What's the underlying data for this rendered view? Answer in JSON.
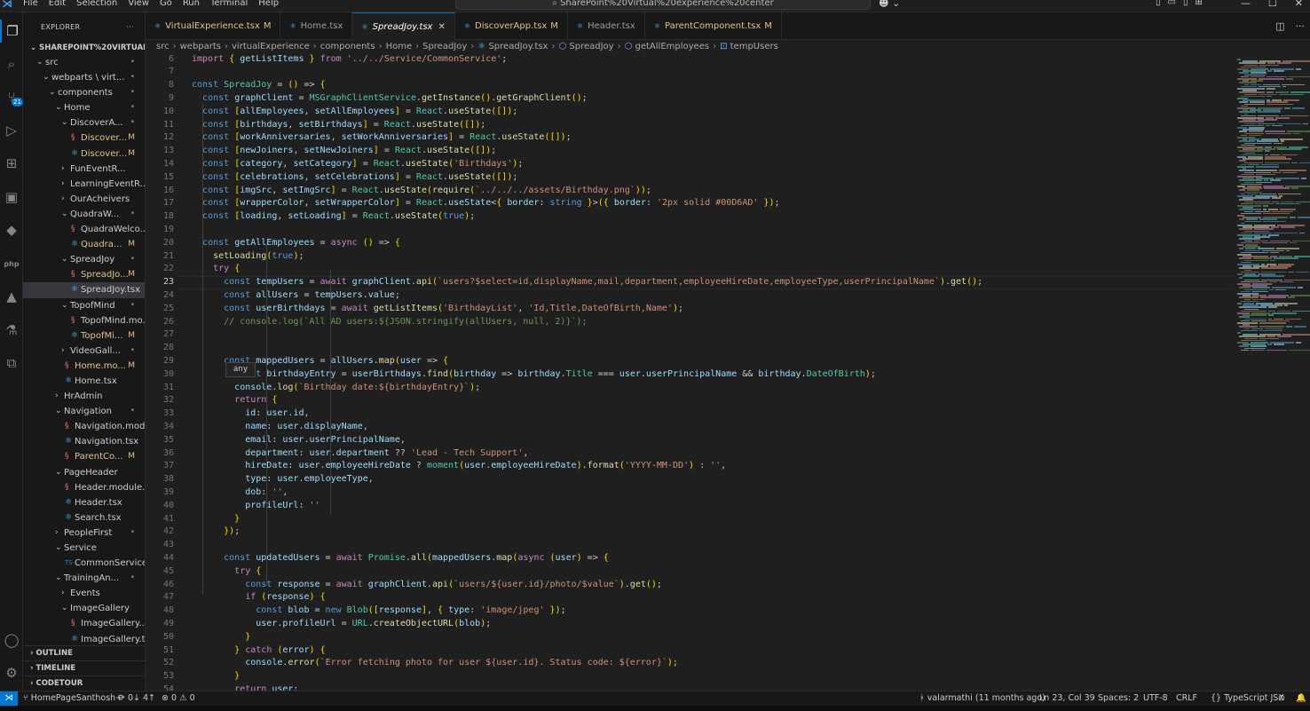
{
  "titlebar": {
    "menu": [
      "File",
      "Edit",
      "Selection",
      "View",
      "Go",
      "Run",
      "Terminal",
      "Help"
    ],
    "command_center": "SharePoint%20Virtual%20experience%20center"
  },
  "activity": {
    "source_control_badge": "21",
    "icons": [
      "files-icon",
      "search-icon",
      "source-control-icon",
      "run-debug-icon",
      "extensions-icon",
      "remote-explorer-icon",
      "python-icon",
      "php-icon",
      "azure-icon",
      "test-icon",
      "docker-icon",
      "account-icon",
      "settings-icon"
    ]
  },
  "explorer": {
    "title": "EXPLORER",
    "more": "···",
    "root": "SHAREPOINT%20VIRTUAL...",
    "rows": [
      {
        "label": "src",
        "indent": 1,
        "chev": "v",
        "status": "•",
        "kind": "folder"
      },
      {
        "label": "webparts \\ virt...",
        "indent": 2,
        "chev": "v",
        "status": "•",
        "kind": "folder"
      },
      {
        "label": "components",
        "indent": 3,
        "chev": "v",
        "status": "•",
        "kind": "folder"
      },
      {
        "label": "Home",
        "indent": 4,
        "chev": "v",
        "status": "•",
        "kind": "folder"
      },
      {
        "label": "DiscoverA...",
        "indent": 5,
        "chev": "v",
        "status": "•",
        "kind": "folder"
      },
      {
        "label": "Discover...",
        "indent": 6,
        "chev": "",
        "status": "M",
        "kind": "scss",
        "mod": true
      },
      {
        "label": "Discover...",
        "indent": 6,
        "chev": "",
        "status": "M",
        "kind": "tsx",
        "mod": true
      },
      {
        "label": "FunEventR...",
        "indent": 5,
        "chev": ">",
        "status": "",
        "kind": "folder"
      },
      {
        "label": "LearningEventR...",
        "indent": 5,
        "chev": ">",
        "status": "",
        "kind": "folder"
      },
      {
        "label": "OurAcheivers",
        "indent": 5,
        "chev": ">",
        "status": "",
        "kind": "folder"
      },
      {
        "label": "QuadraW...",
        "indent": 5,
        "chev": "v",
        "status": "•",
        "kind": "folder"
      },
      {
        "label": "QuadraWelco...",
        "indent": 6,
        "chev": "",
        "status": "",
        "kind": "scss"
      },
      {
        "label": "Quadra...",
        "indent": 6,
        "chev": "",
        "status": "M",
        "kind": "tsx",
        "mod": true
      },
      {
        "label": "SpreadJoy",
        "indent": 5,
        "chev": "v",
        "status": "•",
        "kind": "folder"
      },
      {
        "label": "SpreadJo...",
        "indent": 6,
        "chev": "",
        "status": "M",
        "kind": "scss",
        "mod": true
      },
      {
        "label": "SpreadJoy.tsx",
        "indent": 6,
        "chev": "",
        "status": "",
        "kind": "tsx",
        "sel": true
      },
      {
        "label": "TopofMind",
        "indent": 5,
        "chev": "v",
        "status": "•",
        "kind": "folder"
      },
      {
        "label": "TopofMind.mo...",
        "indent": 6,
        "chev": "",
        "status": "",
        "kind": "scss"
      },
      {
        "label": "TopofMi...",
        "indent": 6,
        "chev": "",
        "status": "M",
        "kind": "tsx",
        "mod": true
      },
      {
        "label": "VideoGall...",
        "indent": 5,
        "chev": ">",
        "status": "•",
        "kind": "folder"
      },
      {
        "label": "Home.mo...",
        "indent": 5,
        "chev": "",
        "status": "M",
        "kind": "scss",
        "mod": true
      },
      {
        "label": "Home.tsx",
        "indent": 5,
        "chev": "",
        "status": "",
        "kind": "tsx"
      },
      {
        "label": "HrAdmin",
        "indent": 4,
        "chev": ">",
        "status": "",
        "kind": "folder"
      },
      {
        "label": "Navigation",
        "indent": 4,
        "chev": "v",
        "status": "•",
        "kind": "folder"
      },
      {
        "label": "Navigation.mod...",
        "indent": 5,
        "chev": "",
        "status": "",
        "kind": "scss"
      },
      {
        "label": "Navigation.tsx",
        "indent": 5,
        "chev": "",
        "status": "",
        "kind": "tsx"
      },
      {
        "label": "ParentCo...",
        "indent": 5,
        "chev": "",
        "status": "M",
        "kind": "scss",
        "mod": true
      },
      {
        "label": "PageHeader",
        "indent": 4,
        "chev": "v",
        "status": "",
        "kind": "folder"
      },
      {
        "label": "Header.module....",
        "indent": 5,
        "chev": "",
        "status": "",
        "kind": "scss"
      },
      {
        "label": "Header.tsx",
        "indent": 5,
        "chev": "",
        "status": "",
        "kind": "tsx"
      },
      {
        "label": "Search.tsx",
        "indent": 5,
        "chev": "",
        "status": "",
        "kind": "tsx"
      },
      {
        "label": "PeopleFirst",
        "indent": 4,
        "chev": ">",
        "status": "•",
        "kind": "folder"
      },
      {
        "label": "Service",
        "indent": 4,
        "chev": "v",
        "status": "",
        "kind": "folder"
      },
      {
        "label": "CommonService....",
        "indent": 5,
        "chev": "",
        "status": "",
        "kind": "ts"
      },
      {
        "label": "TrainingAn...",
        "indent": 4,
        "chev": "v",
        "status": "•",
        "kind": "folder"
      },
      {
        "label": "Events",
        "indent": 5,
        "chev": ">",
        "status": "",
        "kind": "folder"
      },
      {
        "label": "ImageGallery",
        "indent": 5,
        "chev": "v",
        "status": "",
        "kind": "folder"
      },
      {
        "label": "ImageGallery....",
        "indent": 6,
        "chev": "",
        "status": "",
        "kind": "scss"
      },
      {
        "label": "ImageGallery.tsx",
        "indent": 6,
        "chev": "",
        "status": "",
        "kind": "tsx"
      }
    ],
    "sections": [
      "OUTLINE",
      "TIMELINE",
      "CODETOUR"
    ]
  },
  "tabs": [
    {
      "name": "VirtualExperience.tsx",
      "mark": "M",
      "active": false
    },
    {
      "name": "Home.tsx",
      "mark": "",
      "active": false
    },
    {
      "name": "SpreadJoy.tsx",
      "mark": "",
      "active": true
    },
    {
      "name": "DiscoverApp.tsx",
      "mark": "M",
      "active": false
    },
    {
      "name": "Header.tsx",
      "mark": "",
      "active": false
    },
    {
      "name": "ParentComponent.tsx",
      "mark": "M",
      "active": false
    }
  ],
  "breadcrumb": [
    "src",
    "webparts",
    "virtualExperience",
    "components",
    "Home",
    "SpreadJoy",
    "SpreadJoy.tsx",
    "SpreadJoy",
    "getAllEmployees",
    "tempUsers"
  ],
  "editor": {
    "current_line": 23,
    "hover_text": "any",
    "lines": [
      {
        "n": 6,
        "c": "import { getListItems } from '../../Service/CommonService';"
      },
      {
        "n": 7,
        "c": ""
      },
      {
        "n": 8,
        "c": "const SpreadJoy = () => {"
      },
      {
        "n": 9,
        "c": "  const graphClient = MSGraphClientService.getInstance().getGraphClient();"
      },
      {
        "n": 10,
        "c": "  const [allEmployees, setAllEmployees] = React.useState([]);"
      },
      {
        "n": 11,
        "c": "  const [birthdays, setBirthdays] = React.useState([]);"
      },
      {
        "n": 12,
        "c": "  const [workAnniversaries, setWorkAnniversaries] = React.useState([]);"
      },
      {
        "n": 13,
        "c": "  const [newJoiners, setNewJoiners] = React.useState([]);"
      },
      {
        "n": 14,
        "c": "  const [category, setCategory] = React.useState('Birthdays');"
      },
      {
        "n": 15,
        "c": "  const [celebrations, setCelebrations] = React.useState([]);"
      },
      {
        "n": 16,
        "c": "  const [imgSrc, setImgSrc] = React.useState(require(`../../../assets/Birthday.png`));"
      },
      {
        "n": 17,
        "c": "  const [wrapperColor, setWrapperColor] = React.useState<{ border: string }>({ border: '2px solid #00D6AD' });"
      },
      {
        "n": 18,
        "c": "  const [loading, setLoading] = React.useState(true);"
      },
      {
        "n": 19,
        "c": ""
      },
      {
        "n": 20,
        "c": "  const getAllEmployees = async () => {"
      },
      {
        "n": 21,
        "c": "    setLoading(true);"
      },
      {
        "n": 22,
        "c": "    try {"
      },
      {
        "n": 23,
        "c": "      const tempUsers = await graphClient.api(`users?$select=id,displayName,mail,department,employeeHireDate,employeeType,userPrincipalName`).get();"
      },
      {
        "n": 24,
        "c": "      const allUsers = tempUsers.value;"
      },
      {
        "n": 25,
        "c": "      const userBirthdays = await getListItems('BirthdayList', 'Id,Title,DateOfBirth,Name');"
      },
      {
        "n": 26,
        "c": "      // console.log(`All AD users:${JSON.stringify(allUsers, null, 2)}`);"
      },
      {
        "n": 27,
        "c": ""
      },
      {
        "n": 28,
        "c": ""
      },
      {
        "n": 29,
        "c": "      const mappedUsers = allUsers.map(user => {"
      },
      {
        "n": 30,
        "c": "        const birthdayEntry = userBirthdays.find(birthday => birthday.Title === user.userPrincipalName && birthday.DateOfBirth);"
      },
      {
        "n": 31,
        "c": "        console.log(`Birthday date:${birthdayEntry}`);"
      },
      {
        "n": 32,
        "c": "        return {"
      },
      {
        "n": 33,
        "c": "          id: user.id,"
      },
      {
        "n": 34,
        "c": "          name: user.displayName,"
      },
      {
        "n": 35,
        "c": "          email: user.userPrincipalName,"
      },
      {
        "n": 36,
        "c": "          department: user.department ?? 'Lead - Tech Support',"
      },
      {
        "n": 37,
        "c": "          hireDate: user.employeeHireDate ? moment(user.employeeHireDate).format('YYYY-MM-DD') : '',"
      },
      {
        "n": 38,
        "c": "          type: user.employeeType,"
      },
      {
        "n": 39,
        "c": "          dob: '',"
      },
      {
        "n": 40,
        "c": "          profileUrl: ''"
      },
      {
        "n": 41,
        "c": "        }"
      },
      {
        "n": 42,
        "c": "      });"
      },
      {
        "n": 43,
        "c": ""
      },
      {
        "n": 44,
        "c": "      const updatedUsers = await Promise.all(mappedUsers.map(async (user) => {"
      },
      {
        "n": 45,
        "c": "        try {"
      },
      {
        "n": 46,
        "c": "          const response = await graphClient.api(`users/${user.id}/photo/$value`).get();"
      },
      {
        "n": 47,
        "c": "          if (response) {"
      },
      {
        "n": 48,
        "c": "            const blob = new Blob([response], { type: 'image/jpeg' });"
      },
      {
        "n": 49,
        "c": "            user.profileUrl = URL.createObjectURL(blob);"
      },
      {
        "n": 50,
        "c": "          }"
      },
      {
        "n": 51,
        "c": "        } catch (error) {"
      },
      {
        "n": 52,
        "c": "          console.error(`Error fetching photo for user ${user.id}. Status code: ${error}`);"
      },
      {
        "n": 53,
        "c": "        }"
      },
      {
        "n": 54,
        "c": "        return user;"
      }
    ]
  },
  "statusbar": {
    "branch": "HomePageSanthosh+",
    "sync": "0↓ 4↑",
    "problems": "⊗ 0 ⚠ 0",
    "blame": "valarmathi (11 months ago)",
    "position": "Ln 23, Col 39",
    "spaces": "Spaces: 2",
    "encoding": "UTF-8",
    "eol": "CRLF",
    "language": "TypeScript JSX"
  },
  "colors": {
    "accent": "#0078d4",
    "modified": "#e2c08d",
    "keyword": "#569cd6",
    "string": "#ce9178",
    "function": "#dcdcaa",
    "variable": "#9cdcfe",
    "comment": "#6a9955"
  }
}
